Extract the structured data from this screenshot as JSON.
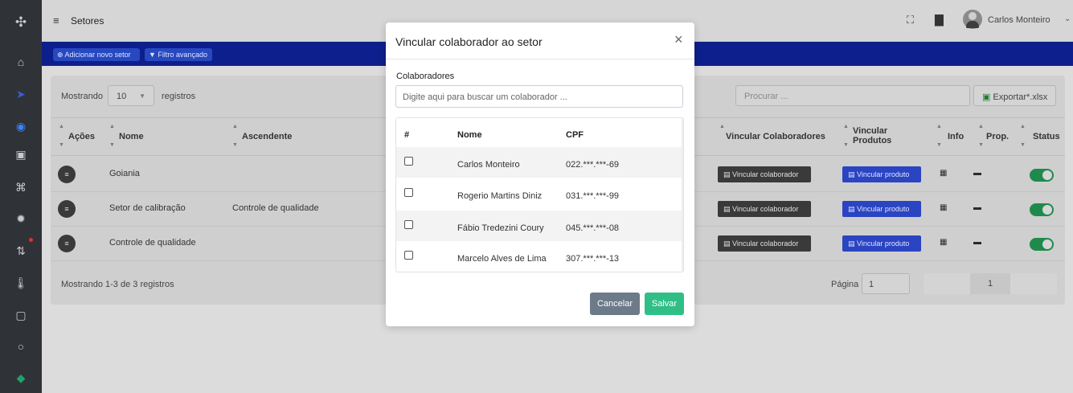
{
  "header": {
    "menu_icon": "hamburger-icon",
    "title": "Setores",
    "user_name": "Carlos Monteiro"
  },
  "actions": {
    "add_label": "Adicionar novo setor",
    "filter_label": "Filtro avançado"
  },
  "table_controls": {
    "showing_label": "Mostrando",
    "page_size": "10",
    "records_label": "registros",
    "search_placeholder": "Procurar ...",
    "export_label": "Exportar*.xlsx"
  },
  "columns": {
    "acoes": "Ações",
    "nome": "Nome",
    "ascendente": "Ascendente",
    "vincular_colaboradores": "Vincular Colaboradores",
    "vincular_produtos_1": "Vincular",
    "vincular_produtos_2": "Produtos",
    "info": "Info",
    "prop": "Prop.",
    "status": "Status"
  },
  "rows": [
    {
      "nome": "Goiania",
      "ascendente": "",
      "vinc_col": "Vincular colaborador",
      "vinc_prod": "Vincular produto",
      "status": true
    },
    {
      "nome": "Setor de calibração",
      "ascendente": "Controle de qualidade",
      "vinc_col": "Vincular colaborador",
      "vinc_prod": "Vincular produto",
      "status": true
    },
    {
      "nome": "Controle de qualidade",
      "ascendente": "",
      "vinc_col": "Vincular colaborador",
      "vinc_prod": "Vincular produto",
      "status": true
    }
  ],
  "footer": {
    "summary": "Mostrando 1-3 de 3 registros",
    "page_label": "Página",
    "page_input": "1",
    "current_page": "1"
  },
  "modal": {
    "title": "Vincular colaborador ao setor",
    "section_label": "Colaboradores",
    "search_placeholder": "Digite aqui para buscar um colaborador ...",
    "col_hash": "#",
    "col_nome": "Nome",
    "col_cpf": "CPF",
    "employees": [
      {
        "nome": "Carlos Monteiro",
        "cpf": "022.***.***-69",
        "checked": false
      },
      {
        "nome": "Rogerio Martins Diniz",
        "cpf": "031.***.***-99",
        "checked": false
      },
      {
        "nome": "Fábio Tredezini Coury",
        "cpf": "045.***.***-08",
        "checked": false
      },
      {
        "nome": "Marcelo Alves de Lima",
        "cpf": "307.***.***-13",
        "checked": false
      }
    ],
    "cancel_label": "Cancelar",
    "save_label": "Salvar"
  },
  "colors": {
    "sidebar": "#2f3338",
    "action_bar": "#0d1f8c",
    "primary_blue": "#2a44c2",
    "toggle_on": "#1f8a4c",
    "save_green": "#2fbf86",
    "cancel_gray": "#6c7a89"
  }
}
